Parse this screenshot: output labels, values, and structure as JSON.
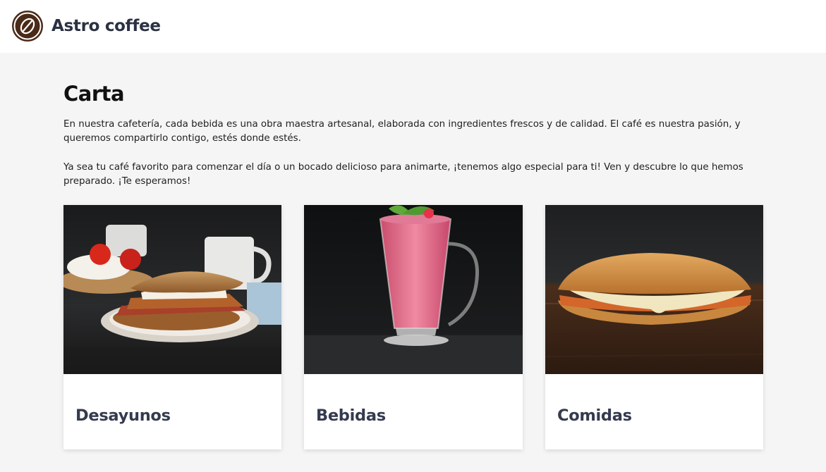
{
  "header": {
    "brand": "Astro coffee",
    "logo_icon": "coffee-bean-icon",
    "brand_color": "#4a2a18"
  },
  "menu": {
    "title": "Carta",
    "paragraphs": [
      "En nuestra cafetería, cada bebida es una obra maestra artesanal, elaborada con ingredientes frescos y de calidad. El café es nuestra pasión, y queremos compartirlo contigo, estés donde estés.",
      "Ya sea tu café favorito para comenzar el día o un bocado delicioso para animarte, ¡tenemos algo especial para ti! Ven y descubre lo que hemos preparado. ¡Te esperamos!"
    ],
    "categories": [
      {
        "label": "Desayunos",
        "image": "breakfast-sandwich-photo"
      },
      {
        "label": "Bebidas",
        "image": "berry-smoothie-photo"
      },
      {
        "label": "Comidas",
        "image": "chicken-sub-sandwich-photo"
      }
    ]
  },
  "colors": {
    "page_background": "#f5f5f5",
    "card_label": "#343b4f",
    "heading": "#111111"
  }
}
